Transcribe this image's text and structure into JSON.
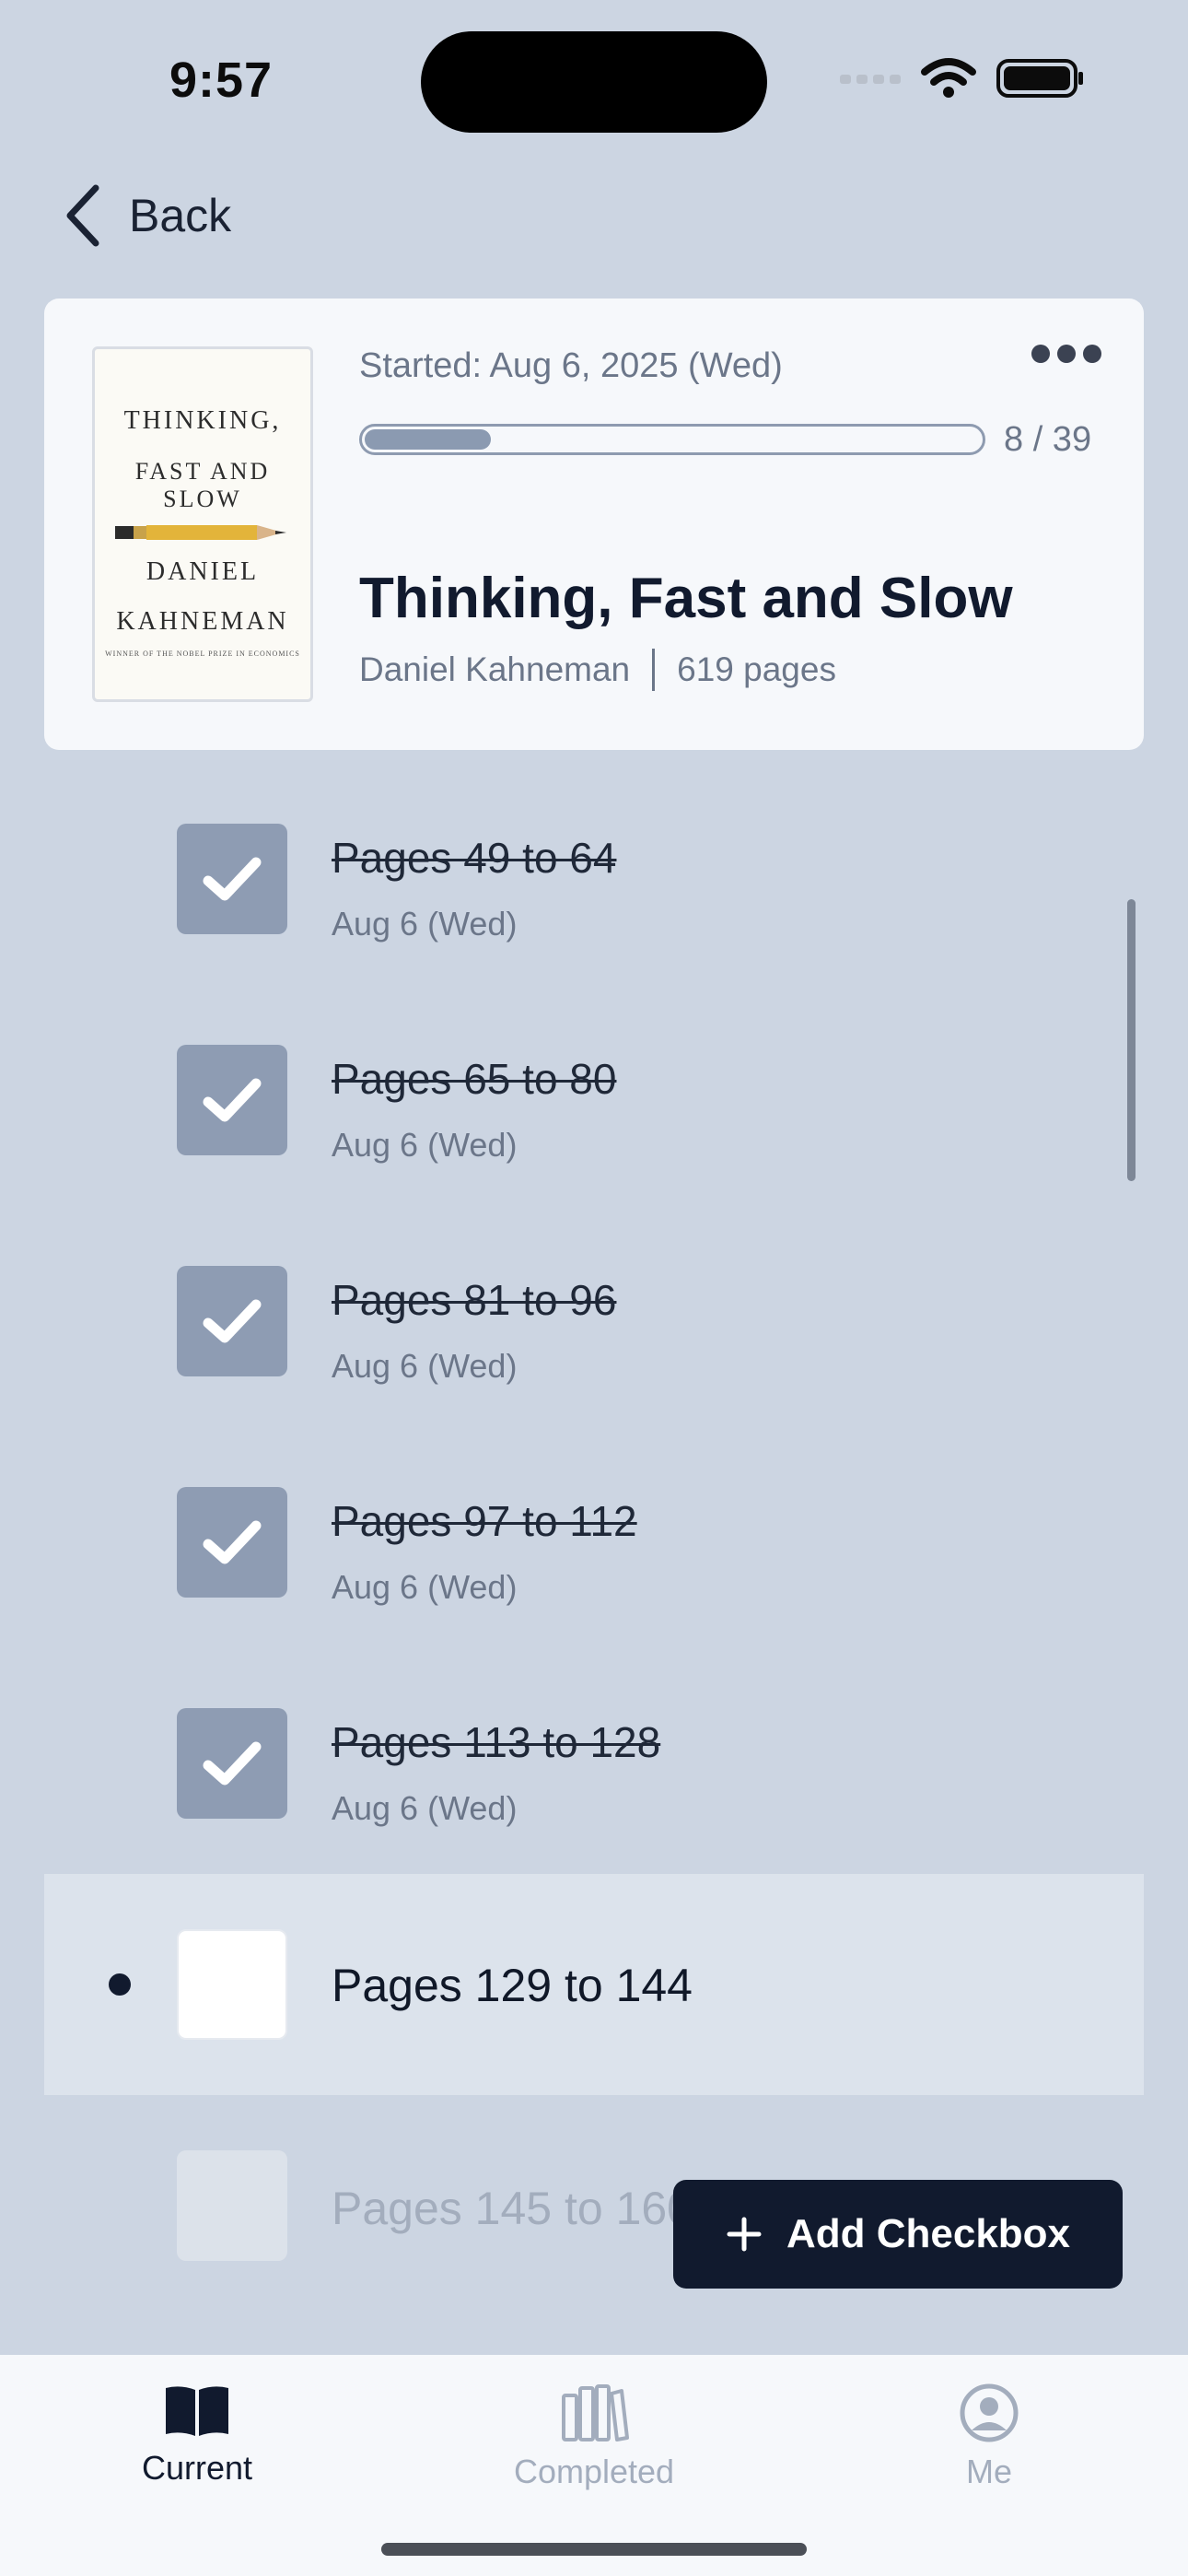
{
  "status_bar": {
    "time": "9:57"
  },
  "nav": {
    "back_label": "Back"
  },
  "book": {
    "cover_lines": [
      "THINKING,",
      "FAST AND SLOW",
      "DANIEL",
      "KAHNEMAN"
    ],
    "cover_subtext": "WINNER OF THE NOBEL PRIZE IN ECONOMICS",
    "started": "Started: Aug 6, 2025 (Wed)",
    "progress": {
      "done": 8,
      "total": 39,
      "text": "8 / 39"
    },
    "title": "Thinking, Fast and Slow",
    "author": "Daniel Kahneman",
    "pages": "619 pages"
  },
  "tasks": [
    {
      "label": "Pages 49 to 64",
      "date": "Aug 6 (Wed)",
      "status": "done"
    },
    {
      "label": "Pages 65 to 80",
      "date": "Aug 6 (Wed)",
      "status": "done"
    },
    {
      "label": "Pages 81 to 96",
      "date": "Aug 6 (Wed)",
      "status": "done"
    },
    {
      "label": "Pages 97 to 112",
      "date": "Aug 6 (Wed)",
      "status": "done"
    },
    {
      "label": "Pages 113 to 128",
      "date": "Aug 6 (Wed)",
      "status": "done"
    },
    {
      "label": "Pages 129 to 144",
      "date": "",
      "status": "current"
    },
    {
      "label": "Pages 145 to 160",
      "date": "",
      "status": "upcoming"
    }
  ],
  "actions": {
    "add_checkbox": "Add Checkbox"
  },
  "tabs": [
    {
      "label": "Current",
      "active": true
    },
    {
      "label": "Completed",
      "active": false
    },
    {
      "label": "Me",
      "active": false
    }
  ],
  "colors": {
    "background": "#ccd5e2",
    "card": "#f6f8fb",
    "accent": "#111a2e",
    "checked": "#8e9cb3",
    "muted": "#6b7689"
  }
}
